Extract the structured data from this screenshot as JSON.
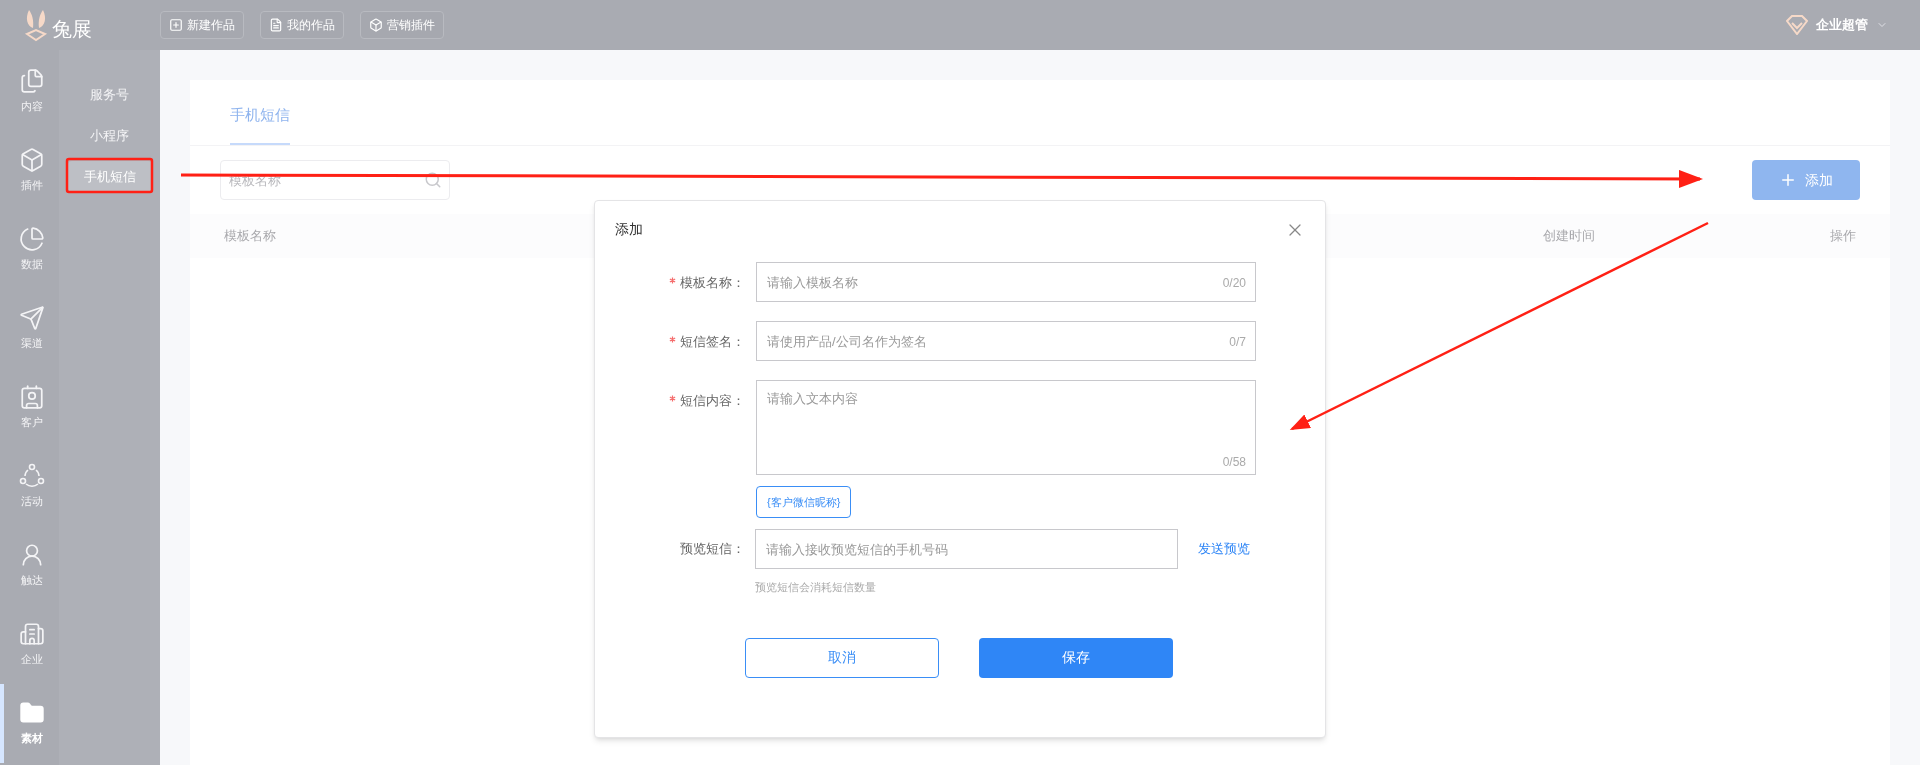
{
  "top_bar": {
    "logo": "兔展",
    "nav": [
      {
        "label": "新建作品"
      },
      {
        "label": "我的作品"
      },
      {
        "label": "营销插件"
      }
    ],
    "user": "企业超管"
  },
  "rail": [
    {
      "label": "内容",
      "selected": false
    },
    {
      "label": "插件",
      "selected": false
    },
    {
      "label": "数据",
      "selected": false
    },
    {
      "label": "渠道",
      "selected": false
    },
    {
      "label": "客户",
      "selected": false
    },
    {
      "label": "活动",
      "selected": false
    },
    {
      "label": "触达",
      "selected": false
    },
    {
      "label": "企业",
      "selected": false
    },
    {
      "label": "素材",
      "selected": true
    }
  ],
  "submenu": [
    {
      "label": "服务号",
      "selected": false
    },
    {
      "label": "小程序",
      "selected": false
    },
    {
      "label": "手机短信",
      "selected": true
    }
  ],
  "page": {
    "tabs": [
      {
        "label": "手机短信",
        "selected": true
      }
    ],
    "search": {
      "placeholder": "模板名称"
    },
    "add_button": "添加",
    "table": {
      "columns": [
        "模板名称",
        "创建时间",
        "操作"
      ]
    }
  },
  "dialog": {
    "title": "添加",
    "fields": [
      {
        "kind": "input",
        "label": "模板名称：",
        "required": true,
        "placeholder": "请输入模板名称",
        "counter": "0/20"
      },
      {
        "kind": "input",
        "label": "短信签名：",
        "required": true,
        "placeholder": "请使用产品/公司名作为签名",
        "counter": "0/7"
      },
      {
        "kind": "textarea",
        "label": "短信内容：",
        "required": true,
        "placeholder": "请输入文本内容",
        "counter": "0/58"
      }
    ],
    "insert_tag": "{客户微信昵称}",
    "preview": {
      "label": "预览短信：",
      "placeholder": "请输入接收预览短信的手机号码",
      "link": "发送预览",
      "hint": "预览短信会消耗短信数量"
    },
    "buttons": [
      {
        "label": "取消",
        "kind": "secondary"
      },
      {
        "label": "保存",
        "kind": "primary"
      }
    ]
  }
}
